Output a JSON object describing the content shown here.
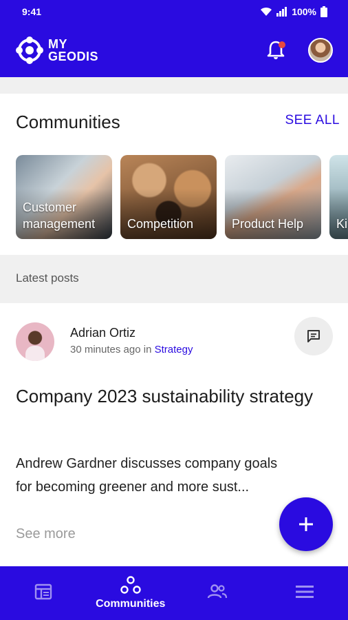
{
  "status_bar": {
    "time": "9:41",
    "battery": "100%"
  },
  "app_bar": {
    "logo_line1": "MY",
    "logo_line2": "GEODIS",
    "accent": "#2a0be0",
    "notification_dot": "#e8493f"
  },
  "communities": {
    "title": "Communities",
    "see_all": "SEE ALL",
    "cards": [
      {
        "label": "Customer management"
      },
      {
        "label": "Competition"
      },
      {
        "label": "Product Help"
      },
      {
        "label": "Ki"
      }
    ]
  },
  "latest": {
    "label": "Latest posts"
  },
  "post": {
    "author": "Adrian Ortiz",
    "time_ago": "30 minutes ago",
    "in_word": "in",
    "category": "Strategy",
    "title": "Company 2023 sustainability strategy",
    "excerpt": "Andrew Gardner discusses company goals for becoming greener and more sust...",
    "see_more": "See more"
  },
  "bottom_nav": {
    "items": [
      {
        "icon": "news-feed-icon",
        "label": ""
      },
      {
        "icon": "communities-icon",
        "label": "Communities"
      },
      {
        "icon": "people-icon",
        "label": ""
      },
      {
        "icon": "menu-icon",
        "label": ""
      }
    ]
  }
}
